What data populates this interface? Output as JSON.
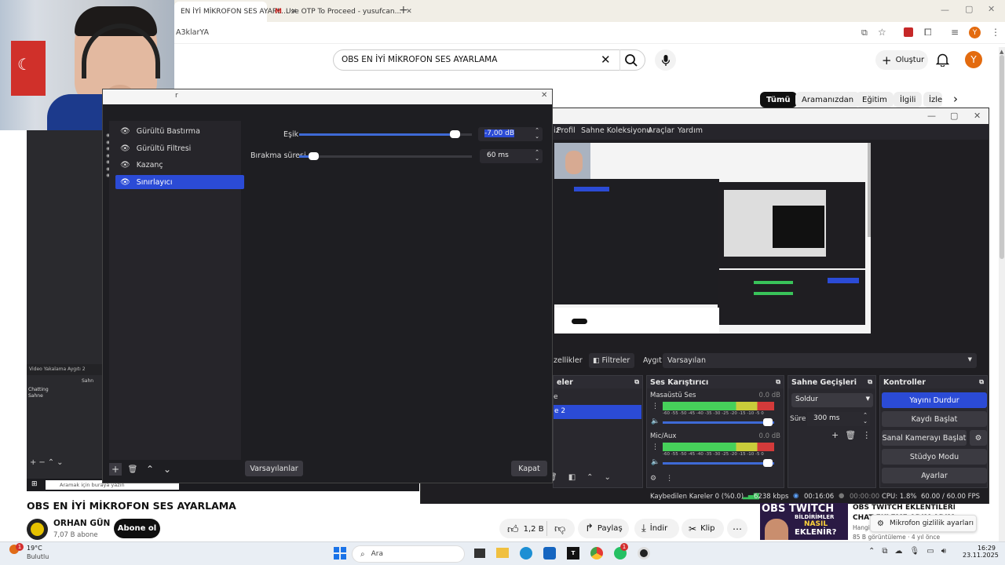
{
  "browser": {
    "tabs": [
      {
        "title": "EN İYİ MİKROFON SES AYARL..."
      },
      {
        "title": "Use OTP To Proceed - yusufcan..."
      }
    ],
    "address_fragment": "A3klarYA"
  },
  "youtube": {
    "search_value": "OBS EN İYİ MİKROFON SES AYARLAMA",
    "create_label": "Oluştur",
    "avatar_letter": "Y",
    "chips": [
      "Tümü",
      "Aramanızdan",
      "Eğitim",
      "İlgili",
      "İzle"
    ],
    "video_title": "OBS EN İYİ MİKROFON SES AYARLAMA",
    "channel_name": "ORHAN GÜN",
    "subscribers": "7,07 B abone",
    "subscribe_label": "Abone ol",
    "likes": "1,2 B",
    "share_label": "Paylaş",
    "download_label": "İndir",
    "clip_label": "Klip",
    "side_video": {
      "thumb_text_1": "OBS TWITCH",
      "thumb_text_2": "BİLDİRİMLER",
      "thumb_text_3": "NASIL",
      "thumb_text_4": "EKLENİR?",
      "title_1": "OBS TWITCH EKLENTİLERİ |",
      "title_2": "CHAT EKLEME ADIM ADIM",
      "channel": "Hangi",
      "meta": "85 B görüntüleme · 4 yıl önce"
    },
    "privacy_tooltip": "Mikrofon gizlilik ayarları"
  },
  "obs": {
    "menu": [
      "iz",
      "Profil",
      "Sahne Koleksiyonu",
      "Araçlar",
      "Yardım"
    ],
    "toolbar": {
      "properties": "zellikler",
      "filters": "Filtreler",
      "device_label": "Aygıt",
      "device_value": "Varsayılan"
    },
    "scenes_head": "eler",
    "scene_row_1": "e",
    "scene_row_2": "e 2",
    "mixer_head": "Ses Karıştırıcı",
    "mixer": [
      {
        "name": "Masaüstü Ses",
        "db": "0.0 dB"
      },
      {
        "name": "Mic/Aux",
        "db": "0.0 dB"
      }
    ],
    "meter_scale": "-60 -55 -50 -45 -40 -35 -30 -25 -20 -15 -10 -5 0",
    "transitions_head": "Sahne Geçişleri",
    "transition": "Soldur",
    "duration_label": "Süre",
    "duration_value": "300 ms",
    "controls_head": "Kontroller",
    "controls": {
      "stop_stream": "Yayını Durdur",
      "start_record": "Kaydı Başlat",
      "virtual_cam": "Sanal Kamerayı Başlat",
      "studio_mode": "Stüdyo Modu",
      "settings": "Ayarlar"
    },
    "status": {
      "dropped": "Kaybedilen Kareler 0 (%0.0)",
      "bitrate": "6238 kbps",
      "live_time": "00:16:06",
      "rec_time": "00:00:00",
      "cpu": "CPU: 1.8%",
      "fps": "60.00 / 60.00 FPS"
    }
  },
  "filters": {
    "title_fragment": "r",
    "items": [
      "Gürültü Bastırma",
      "Gürültü Filtresi",
      "Kazanç",
      "Sınırlayıcı"
    ],
    "selected_index": 3,
    "threshold_label": "Eşik",
    "threshold_value": "-7,00 dB",
    "threshold_level": 0.9,
    "release_label": "Bırakma süresi",
    "release_value": "60 ms",
    "release_level": 0.08,
    "defaults_label": "Varsayılanlar",
    "close_label": "Kapat"
  },
  "webcam_bg": {
    "src_label": "Video Yakalama Aygıtı 2",
    "src_btn": "Sahn",
    "list_1": "Chatting",
    "list_2": "Sahne",
    "taskbar_search": "Aramak için buraya yazın"
  },
  "taskbar": {
    "weather_temp": "19°C",
    "weather_desc": "Bulutlu",
    "weather_badge": "1",
    "search": "Ara",
    "time": "16:29",
    "date": "23.11.2025",
    "notif_badge": "1"
  },
  "colors": {
    "accent_blue": "#2b4bd6",
    "youtube_red": "#ff0033",
    "avatar_orange": "#e36b0f"
  }
}
